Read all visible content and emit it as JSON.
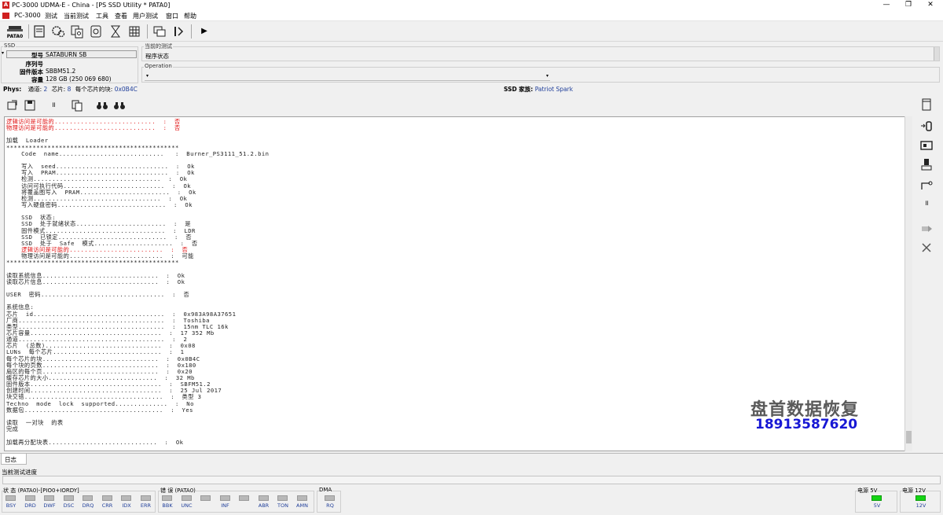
{
  "window": {
    "title": "PC-3000 UDMA-E - China - [PS SSD Utility * PATA0]",
    "app_icon": "A",
    "min_glyph": "—",
    "max_glyph": "❐",
    "close_glyph": "✕"
  },
  "menu": [
    "PC-3000",
    "测试",
    "当前测试",
    "工具",
    "查看",
    "用户测试",
    "窗口",
    "帮助"
  ],
  "toolbar": {
    "pata_label": "PATA0",
    "play_glyph": "▶"
  },
  "ssd_panel": {
    "group_label": "SSD",
    "rows": [
      {
        "key": "型号",
        "value": "SATABURN   SB"
      },
      {
        "key": "序列号",
        "value": ""
      },
      {
        "key": "固件版本",
        "value": "SBBM51.2"
      },
      {
        "key": "容量",
        "value": "128 GB (250 069 680)"
      }
    ]
  },
  "current_test": {
    "group_label": "当前的测试",
    "value": "程序状态"
  },
  "operation": {
    "group_label": "Operation",
    "value": ""
  },
  "phys": {
    "label": "Phys:",
    "channel_label": "通道:",
    "channel_value": "2",
    "chips_label": "芯片:",
    "chips_value": "8",
    "blocks_label": "每个芯片的块:",
    "blocks_value": "0x0B4C",
    "family_label": "SSD 家族:",
    "family_value": "Patriot Spark"
  },
  "log_lines": [
    {
      "text": "逻辑访问是可能的...........................  :  否",
      "red": true
    },
    {
      "text": "物理访问是可能的...........................  :  否",
      "red": true
    },
    {
      "text": "",
      "red": false
    },
    {
      "text": "加载  Loader",
      "red": false
    },
    {
      "text": "**********************************************",
      "red": false
    },
    {
      "text": "    Code  name............................   :  Burner_PS3111_51.2.bin",
      "red": false
    },
    {
      "text": "",
      "red": false
    },
    {
      "text": "    写入  seed..............................  :  Ok",
      "red": false
    },
    {
      "text": "    写入  PRAM..............................  :  Ok",
      "red": false
    },
    {
      "text": "    检测..................................  :  Ok",
      "red": false
    },
    {
      "text": "    访问可执行代码...........................  :  Ok",
      "red": false
    },
    {
      "text": "    将覆盖图写入  PRAM........................  :  Ok",
      "red": false
    },
    {
      "text": "    检测..................................  :  Ok",
      "red": false
    },
    {
      "text": "    写入硬盘密码.............................  :  Ok",
      "red": false
    },
    {
      "text": "",
      "red": false
    },
    {
      "text": "    SSD  状态:",
      "red": false
    },
    {
      "text": "    SSD  处于就绪状态........................  :  是",
      "red": false
    },
    {
      "text": "    固件模式................................  :  LDR",
      "red": false
    },
    {
      "text": "    SSD  已锁定.............................  :  否",
      "red": false
    },
    {
      "text": "    SSD  处于  Safe  模式.....................  :  否",
      "red": false
    },
    {
      "text": "    逻辑访问是可能的.........................  :  否",
      "red": true
    },
    {
      "text": "    物理访问是可能的.........................  :  可能",
      "red": false
    },
    {
      "text": "**********************************************",
      "red": false
    },
    {
      "text": "",
      "red": false
    },
    {
      "text": "读取系统信息...............................  :  Ok",
      "red": false
    },
    {
      "text": "读取芯片信息...............................  :  Ok",
      "red": false
    },
    {
      "text": "",
      "red": false
    },
    {
      "text": "USER  密码.................................  :  否",
      "red": false
    },
    {
      "text": "",
      "red": false
    },
    {
      "text": "系统信息:",
      "red": false
    },
    {
      "text": "芯片  id...................................  :  0x983A98A37651",
      "red": false
    },
    {
      "text": "厂商.......................................  :  Toshiba",
      "red": false
    },
    {
      "text": "类型.......................................  :  15nm TLC 16k",
      "red": false
    },
    {
      "text": "芯片容量...................................  :  17 352 Mb",
      "red": false
    },
    {
      "text": "通道.......................................  :  2",
      "red": false
    },
    {
      "text": "芯片  (总数)...............................  :  0x08",
      "red": false
    },
    {
      "text": "LUNs  每个芯片.............................  :  1",
      "red": false
    },
    {
      "text": "每个芯片的块...............................  :  0x0B4C",
      "red": false
    },
    {
      "text": "每个块的页数...............................  :  0x180",
      "red": false
    },
    {
      "text": "扇区的每个页...............................  :  0x20",
      "red": false
    },
    {
      "text": "缓存芯片的大小.............................  :  32 Mb",
      "red": false
    },
    {
      "text": "固件版本...................................  :  SBFM51.2",
      "red": false
    },
    {
      "text": "创建时间...................................  :  25 Jul 2017",
      "red": false
    },
    {
      "text": "块交错.....................................  :  类型 3",
      "red": false
    },
    {
      "text": "Techno  mode  lock  supported..............  :  No",
      "red": false
    },
    {
      "text": "数据包.....................................  :  Yes",
      "red": false
    },
    {
      "text": "",
      "red": false
    },
    {
      "text": "读取  一对块  的表",
      "red": false
    },
    {
      "text": "完成",
      "red": false
    },
    {
      "text": "",
      "red": false
    },
    {
      "text": "加载再分配块表.............................  :  Ok",
      "red": false
    }
  ],
  "watermark": {
    "company": "盘首数据恢复",
    "phone": "18913587620"
  },
  "tabs": {
    "log_tab": "日志"
  },
  "progress_label": "当前测试进度",
  "status": {
    "state_label": "状 态 (PATA0)-[PIO0+IORDY]",
    "state_leds": [
      {
        "label": "BSY",
        "on": false
      },
      {
        "label": "DRD",
        "on": false
      },
      {
        "label": "DWF",
        "on": false
      },
      {
        "label": "DSC",
        "on": false
      },
      {
        "label": "DRQ",
        "on": false
      },
      {
        "label": "CRR",
        "on": false
      },
      {
        "label": "IDX",
        "on": false
      },
      {
        "label": "ERR",
        "on": false
      }
    ],
    "error_label": "错 误 (PATA0)",
    "error_leds": [
      {
        "label": "BBK",
        "on": false
      },
      {
        "label": "UNC",
        "on": false
      },
      {
        "label": "",
        "on": false
      },
      {
        "label": "INF",
        "on": false
      },
      {
        "label": "",
        "on": false
      },
      {
        "label": "ABR",
        "on": false
      },
      {
        "label": "TON",
        "on": false
      },
      {
        "label": "AMN",
        "on": false
      }
    ],
    "dma_label": "DMA",
    "dma_led": {
      "label": "RQ",
      "on": false
    },
    "power5_label": "电源 5V",
    "power5_led": {
      "label": "5V",
      "on": true
    },
    "power12_label": "电源 12V",
    "power12_led": {
      "label": "12V",
      "on": true
    }
  },
  "colors": {
    "led_on": "#15d415",
    "led_off": "#b8b8b8",
    "log_error": "#e01010",
    "link_blue": "#1f3e9a"
  }
}
